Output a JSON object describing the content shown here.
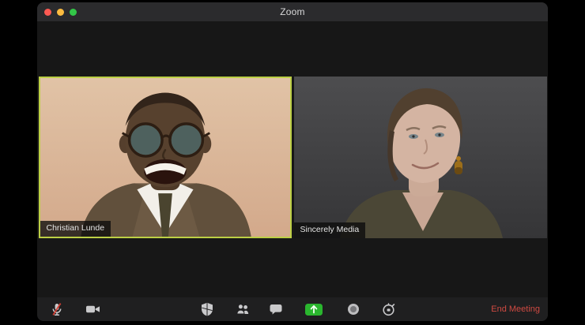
{
  "window": {
    "title": "Zoom"
  },
  "titlebar": {
    "buttons": [
      "close",
      "minimize",
      "fullscreen"
    ]
  },
  "video_grid": {
    "participants": [
      {
        "name": "Christian Lunde",
        "active_speaker": true
      },
      {
        "name": "Sincerely Media",
        "active_speaker": false
      }
    ]
  },
  "toolbar": {
    "mute": {
      "icon": "mic-muted-icon",
      "muted": true
    },
    "video": {
      "icon": "video-camera-icon",
      "on": true
    },
    "security": {
      "icon": "shield-icon"
    },
    "participants": {
      "icon": "participants-icon"
    },
    "chat": {
      "icon": "chat-bubble-icon"
    },
    "share_screen": {
      "icon": "share-screen-icon"
    },
    "record": {
      "icon": "record-icon"
    },
    "reactions": {
      "icon": "stopwatch-icon"
    },
    "end_meeting_label": "End Meeting"
  },
  "colors": {
    "active_speaker_border": "#bccf45",
    "share_button": "#2ab62e",
    "end_meeting_text": "#cf4a42",
    "mute_slash": "#d23f34",
    "titlebar_bg": "#2b2b2d",
    "window_bg": "#181818",
    "toolbar_bg": "#1f1f20",
    "traffic_red": "#fc5a53",
    "traffic_yellow": "#fdbc40",
    "traffic_green": "#33c748"
  }
}
